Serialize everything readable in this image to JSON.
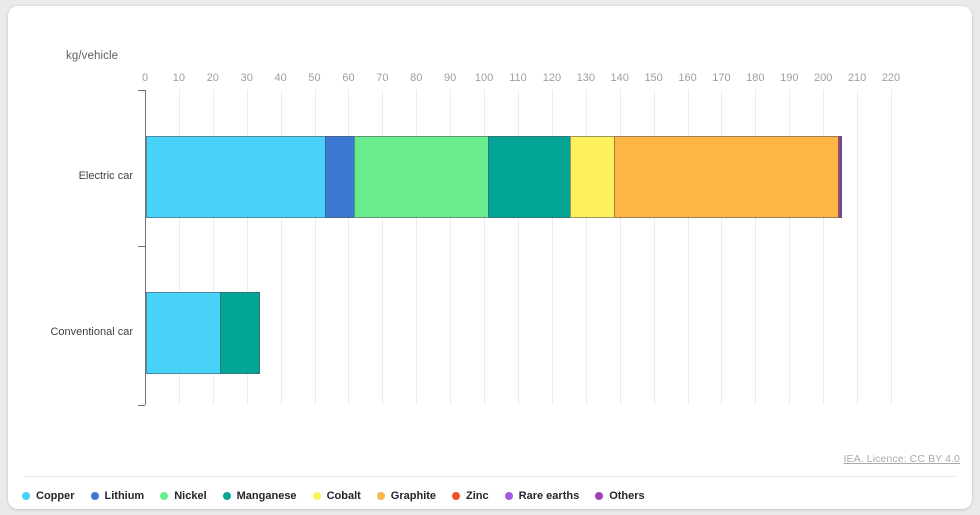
{
  "chart_data": {
    "type": "bar",
    "orientation": "horizontal",
    "stacked": true,
    "title": "",
    "subtitle": "",
    "xlabel": "",
    "ylabel": "kg/vehicle",
    "unit_label": "kg/vehicle",
    "xlim": [
      0,
      220
    ],
    "xticks": [
      0,
      10,
      20,
      30,
      40,
      50,
      60,
      70,
      80,
      90,
      100,
      110,
      120,
      130,
      140,
      150,
      160,
      170,
      180,
      190,
      200,
      210,
      220
    ],
    "xtick_labels": [
      "0",
      "10",
      "20",
      "30",
      "40",
      "50",
      "60",
      "70",
      "80",
      "90",
      "100",
      "110",
      "120",
      "130",
      "140",
      "150",
      "160",
      "170",
      "180",
      "190",
      "200",
      "210",
      "220"
    ],
    "grid": true,
    "legend_position": "bottom",
    "categories": [
      "Electric car",
      "Conventional car"
    ],
    "series": [
      {
        "name": "Copper",
        "color": "#49d2f9",
        "values": [
          53,
          22
        ]
      },
      {
        "name": "Lithium",
        "color": "#3d79d2",
        "values": [
          8.9,
          0
        ]
      },
      {
        "name": "Nickel",
        "color": "#69ec8e",
        "values": [
          39.9,
          0
        ]
      },
      {
        "name": "Manganese",
        "color": "#03a696",
        "values": [
          24.5,
          12
        ]
      },
      {
        "name": "Cobalt",
        "color": "#fdf05a",
        "values": [
          13.3,
          0
        ]
      },
      {
        "name": "Graphite",
        "color": "#fdb545",
        "values": [
          66.3,
          0
        ]
      },
      {
        "name": "Zinc",
        "color": "#f0502a",
        "values": [
          0.1,
          0
        ]
      },
      {
        "name": "Rare earths",
        "color": "#a05de0",
        "values": [
          0.6,
          0
        ]
      },
      {
        "name": "Others",
        "color": "#9c41b8",
        "values": [
          0.6,
          0
        ]
      }
    ]
  },
  "footer": {
    "licence": "IEA. Licence: CC BY 4.0"
  }
}
